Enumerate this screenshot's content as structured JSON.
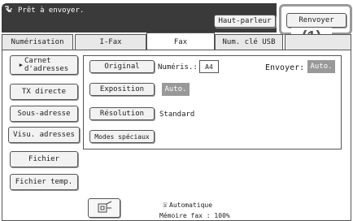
{
  "status": {
    "icon": "printer-icon",
    "text": "Prêt à envoyer."
  },
  "header": {
    "speaker_label": "Haut-parleur",
    "resend_label": "Renvoyer"
  },
  "callout": "(1)",
  "tabs": [
    "Numérisation",
    "I-Fax",
    "Fax",
    "Num. clé USB",
    ""
  ],
  "active_tab": "Fax",
  "sidebar": {
    "items": [
      {
        "label": "Carnet\nd'adresses"
      },
      {
        "label": "TX directe"
      },
      {
        "label": "Sous-adresse"
      },
      {
        "label": "Visu. adresses"
      },
      {
        "label": "Fichier"
      },
      {
        "label": "Fichier temp."
      }
    ]
  },
  "settings": {
    "original_label": "Original",
    "scan_label": "Numéris.:",
    "scan_value": "A4",
    "send_label": "Envoyer:",
    "send_value": "Auto.",
    "exposure_label": "Exposition",
    "exposure_value": "Auto.",
    "resolution_label": "Résolution",
    "resolution_value": "Standard",
    "special_modes_label": "Modes spéciaux"
  },
  "footer": {
    "mode": "Automatique",
    "memory": "Mémoire fax : 100%"
  },
  "colors": {
    "topbar": "#3a3a3a",
    "value_bg": "#999999",
    "highlight": "#999999"
  }
}
